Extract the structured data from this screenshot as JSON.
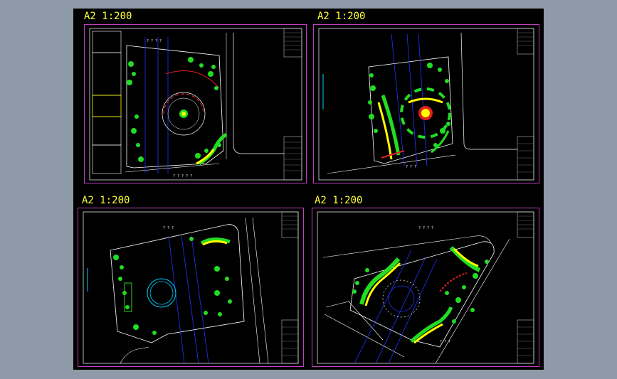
{
  "app": {
    "window": "CAD drawing viewport"
  },
  "colors": {
    "background": "#8e9aa8",
    "viewport": "#000000",
    "frame": "#c040c0",
    "linework": "#ffffff",
    "road_axis": "#2233ff",
    "planting": "#22dd22",
    "accent_yellow": "#ffff00",
    "accent_red": "#e02020",
    "cyan": "#00d0ff",
    "label": "#ffff3a"
  },
  "sheets": [
    {
      "label": "A2 1:200"
    },
    {
      "label": "A2 1:200"
    },
    {
      "label": "A2 1:200"
    },
    {
      "label": "A2 1:200"
    }
  ]
}
